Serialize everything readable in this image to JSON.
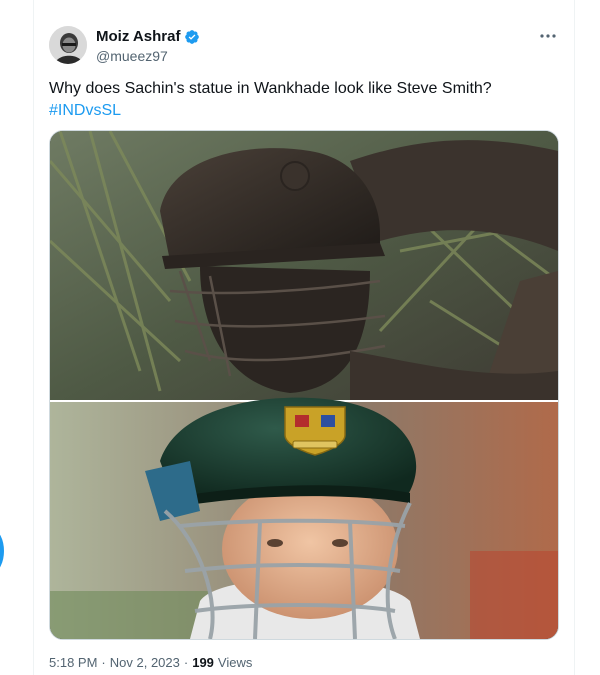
{
  "author": {
    "display_name": "Moiz Ashraf",
    "handle": "@mueez97",
    "verified": true,
    "verified_color": "#1d9bf0"
  },
  "tweet": {
    "text": "Why does Sachin's statue in Wankhade look like Steve Smith?",
    "hashtag": "#INDvsSL",
    "media": {
      "top_image": "bronze statue of cricketer in helmet among palm leaves",
      "bottom_image": "cricketer in green Australia helmet with baggy green crest"
    }
  },
  "meta": {
    "time": "5:18 PM",
    "separator": "·",
    "date": "Nov 2, 2023",
    "views_count": "199",
    "views_label": "Views"
  },
  "icons": {
    "more": "more-horizontal-icon",
    "verified": "verified-badge-icon"
  },
  "colors": {
    "link": "#1d9bf0",
    "secondary_text": "#536471",
    "primary_text": "#0f1419"
  }
}
